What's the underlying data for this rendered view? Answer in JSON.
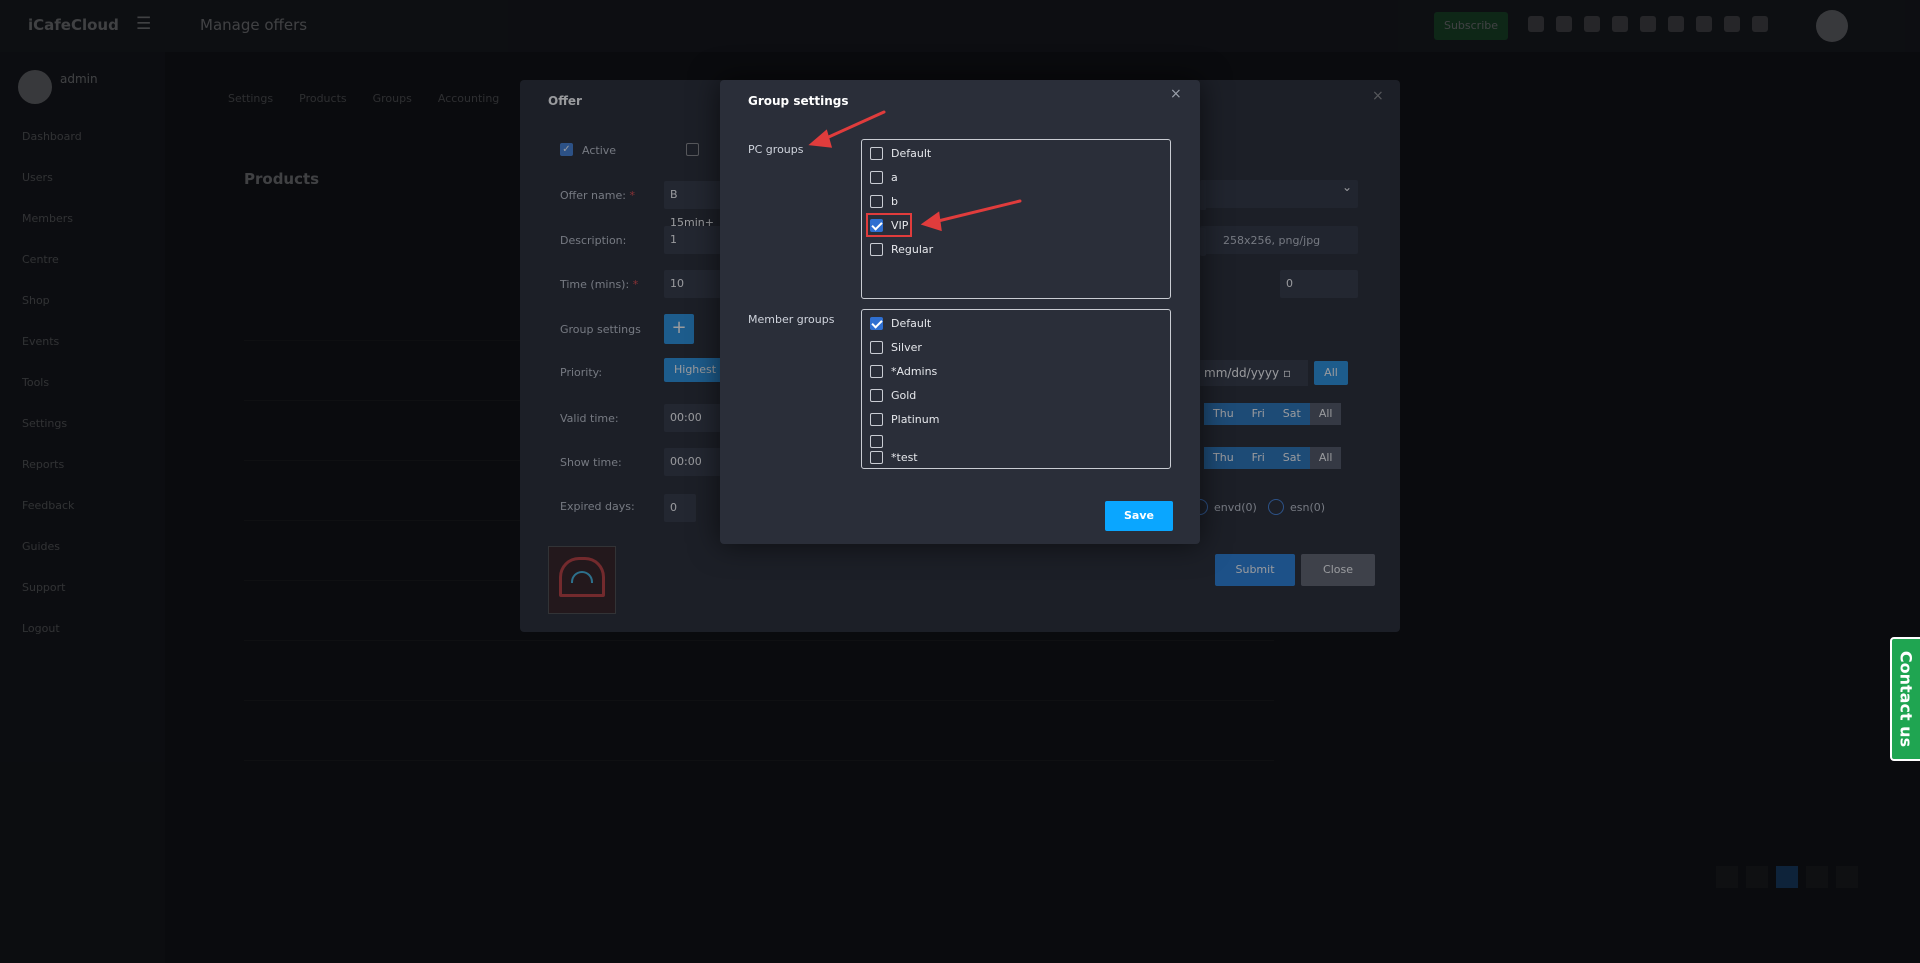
{
  "app": {
    "logo": "iCafeCloud",
    "page_title": "Manage offers",
    "subscribe": "Subscribe",
    "user_name": "admin",
    "sidebar": [
      "Dashboard",
      "Users",
      "Members",
      "Centre",
      "Shop",
      "Events",
      "Tools",
      "Settings",
      "Reports",
      "Feedback",
      "Guides",
      "Support",
      "Logout"
    ],
    "tabs": [
      "Settings",
      "Products",
      "Groups",
      "Accounting"
    ],
    "products_title": "Products"
  },
  "offer": {
    "title": "Offer",
    "active_label": "Active",
    "offer_name_label": "Offer name:",
    "offer_name_value": "B 15min+",
    "description_label": "Description:",
    "description_value": "1",
    "time_label": "Time (mins):",
    "time_value": "10",
    "group_settings_label": "Group settings",
    "priority_label": "Priority:",
    "priority_value": "Highest",
    "valid_time_label": "Valid time:",
    "valid_time_value": "00:00",
    "show_time_label": "Show time:",
    "show_time_value": "00:00",
    "expired_days_label": "Expired days:",
    "expired_days_value": "0",
    "image_hint": "258x256, png/jpg",
    "price_value": "0",
    "date_placeholder": "mm/dd/yyyy",
    "all_label": "All",
    "days": [
      "Thu",
      "Fri",
      "Sat",
      "All"
    ],
    "radio_envd": "envd(0)",
    "radio_esn": "esn(0)",
    "submit_label": "Submit",
    "close_label": "Close"
  },
  "group_settings": {
    "title": "Group settings",
    "close_symbol": "×",
    "pc_groups_label": "PC groups",
    "pc_groups": [
      {
        "label": "Default",
        "checked": false
      },
      {
        "label": "a",
        "checked": false
      },
      {
        "label": "b",
        "checked": false
      },
      {
        "label": "VIP",
        "checked": true
      },
      {
        "label": "Regular",
        "checked": false
      }
    ],
    "member_groups_label": "Member groups",
    "member_groups": [
      {
        "label": "Default",
        "checked": true
      },
      {
        "label": "Silver",
        "checked": false
      },
      {
        "label": "*Admins",
        "checked": false
      },
      {
        "label": "Gold",
        "checked": false
      },
      {
        "label": "Platinum",
        "checked": false
      },
      {
        "label": "",
        "checked": false
      },
      {
        "label": "*test",
        "checked": false
      }
    ],
    "save_label": "Save"
  },
  "contact_us": "Contact us",
  "colors": {
    "annotation": "#e03c3c",
    "save_button": "#0aa6ff",
    "checkbox_on": "#2f6fd1",
    "contact": "#1fa551"
  }
}
